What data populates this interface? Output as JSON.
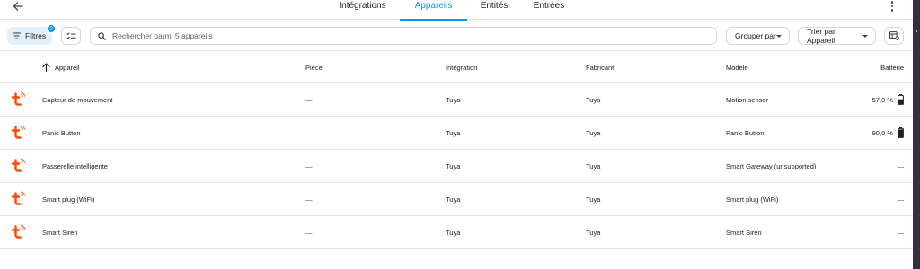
{
  "tabs": [
    {
      "label": "Intégrations",
      "active": false
    },
    {
      "label": "Appareils",
      "active": true
    },
    {
      "label": "Entités",
      "active": false
    },
    {
      "label": "Entrées",
      "active": false
    }
  ],
  "toolbar": {
    "filters_label": "Filtres",
    "filters_count": "2",
    "search_placeholder": "Rechercher parmi 5 appareils",
    "group_by_label": "Grouper par",
    "sort_by_label": "Trier par Appareil"
  },
  "table": {
    "headers": {
      "device": "Appareil",
      "room": "Pièce",
      "integration": "Intégration",
      "manufacturer": "Fabricant",
      "model": "Modèle",
      "battery": "Batterie"
    },
    "rows": [
      {
        "name": "Capteur de mouvement",
        "room": "—",
        "integration": "Tuya",
        "manufacturer": "Tuya",
        "model": "Motion sensor",
        "battery": "57,0 %",
        "battery_level": 0.57
      },
      {
        "name": "Panic Button",
        "room": "—",
        "integration": "Tuya",
        "manufacturer": "Tuya",
        "model": "Panic Button",
        "battery": "90,0 %",
        "battery_level": 0.9
      },
      {
        "name": "Passerelle intelligente",
        "room": "—",
        "integration": "Tuya",
        "manufacturer": "Tuya",
        "model": "Smart Gateway (unsupported)",
        "battery": "—",
        "battery_level": null
      },
      {
        "name": "Smart plug (WiFi)",
        "room": "—",
        "integration": "Tuya",
        "manufacturer": "Tuya",
        "model": "Smart plug (WiFi)",
        "battery": "—",
        "battery_level": null
      },
      {
        "name": "Smart Siren",
        "room": "—",
        "integration": "Tuya",
        "manufacturer": "Tuya",
        "model": "Smart Siren",
        "battery": "—",
        "battery_level": null
      }
    ]
  },
  "colors": {
    "accent": "#039be5",
    "tuya": "#ff4800",
    "filter_bg": "#e1f0fa"
  },
  "icons": [
    "back-arrow-icon",
    "more-vert-icon",
    "filter-icon",
    "select-mode-icon",
    "search-icon",
    "sort-arrow-up-icon",
    "table-settings-icon",
    "tuya-logo-icon",
    "battery-icon"
  ]
}
